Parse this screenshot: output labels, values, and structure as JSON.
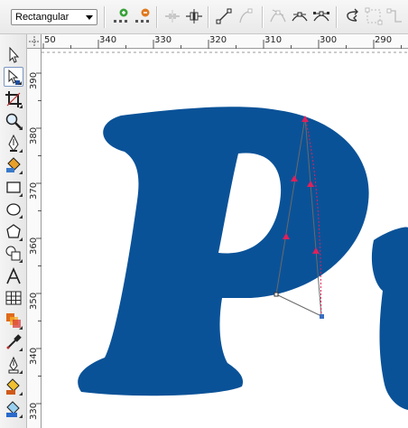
{
  "property_bar": {
    "selection_mode": "Rectangular",
    "buttons": [
      {
        "name": "add-node-button",
        "icon": "add-node-icon",
        "enabled": true
      },
      {
        "name": "delete-node-button",
        "icon": "delete-node-icon",
        "enabled": true
      },
      {
        "name": "join-nodes-button",
        "icon": "join-nodes-icon",
        "enabled": false
      },
      {
        "name": "break-curve-button",
        "icon": "break-curve-icon",
        "enabled": true
      },
      {
        "name": "to-line-button",
        "icon": "to-line-icon",
        "enabled": true
      },
      {
        "name": "to-curve-button",
        "icon": "to-curve-icon",
        "enabled": false
      },
      {
        "name": "cusp-node-button",
        "icon": "cusp-node-icon",
        "enabled": false
      },
      {
        "name": "smooth-node-button",
        "icon": "smooth-node-icon",
        "enabled": true
      },
      {
        "name": "symmetrical-node-button",
        "icon": "symmetrical-node-icon",
        "enabled": true
      },
      {
        "name": "reverse-direction-button",
        "icon": "reverse-direction-icon",
        "enabled": true
      },
      {
        "name": "extend-curve-button",
        "icon": "extend-curve-icon",
        "enabled": false
      },
      {
        "name": "extract-subpath-button",
        "icon": "extract-subpath-icon",
        "enabled": false
      }
    ]
  },
  "toolbox": {
    "tools": [
      {
        "name": "pick-tool",
        "icon": "pointer-arrow-icon",
        "active": false
      },
      {
        "name": "shape-tool",
        "icon": "shape-node-icon",
        "active": true
      },
      {
        "name": "crop-tool",
        "icon": "crop-icon",
        "active": false
      },
      {
        "name": "zoom-tool",
        "icon": "magnifier-icon",
        "active": false
      },
      {
        "name": "freehand-tool",
        "icon": "pen-nib-icon",
        "active": false
      },
      {
        "name": "smart-fill-tool",
        "icon": "paint-bucket-icon",
        "active": false
      },
      {
        "name": "rectangle-tool",
        "icon": "rectangle-icon",
        "active": false
      },
      {
        "name": "ellipse-tool",
        "icon": "ellipse-icon",
        "active": false
      },
      {
        "name": "polygon-tool",
        "icon": "polygon-icon",
        "active": false
      },
      {
        "name": "basic-shapes-tool",
        "icon": "basic-shapes-icon",
        "active": false
      },
      {
        "name": "text-tool",
        "icon": "text-a-icon",
        "active": false
      },
      {
        "name": "table-tool",
        "icon": "table-grid-icon",
        "active": false
      },
      {
        "name": "interactive-effects-tool",
        "icon": "blend-icon",
        "active": false
      },
      {
        "name": "eyedropper-tool",
        "icon": "eyedropper-icon",
        "active": false
      },
      {
        "name": "outline-pen-tool",
        "icon": "outline-pen-icon",
        "active": false
      },
      {
        "name": "fill-tool",
        "icon": "fill-bucket-icon",
        "active": false
      },
      {
        "name": "interactive-fill-tool",
        "icon": "interactive-fill-icon",
        "active": false
      }
    ]
  },
  "rulers": {
    "horizontal_labels": [
      "50",
      "340",
      "330",
      "320",
      "310",
      "300",
      "290"
    ],
    "vertical_labels": [
      "390",
      "380",
      "370",
      "360",
      "350",
      "340",
      "330"
    ]
  },
  "canvas": {
    "glyph_fill": "#0a5298",
    "node_color": "#e0205a",
    "control_handle_color": "#3a6ec0"
  }
}
